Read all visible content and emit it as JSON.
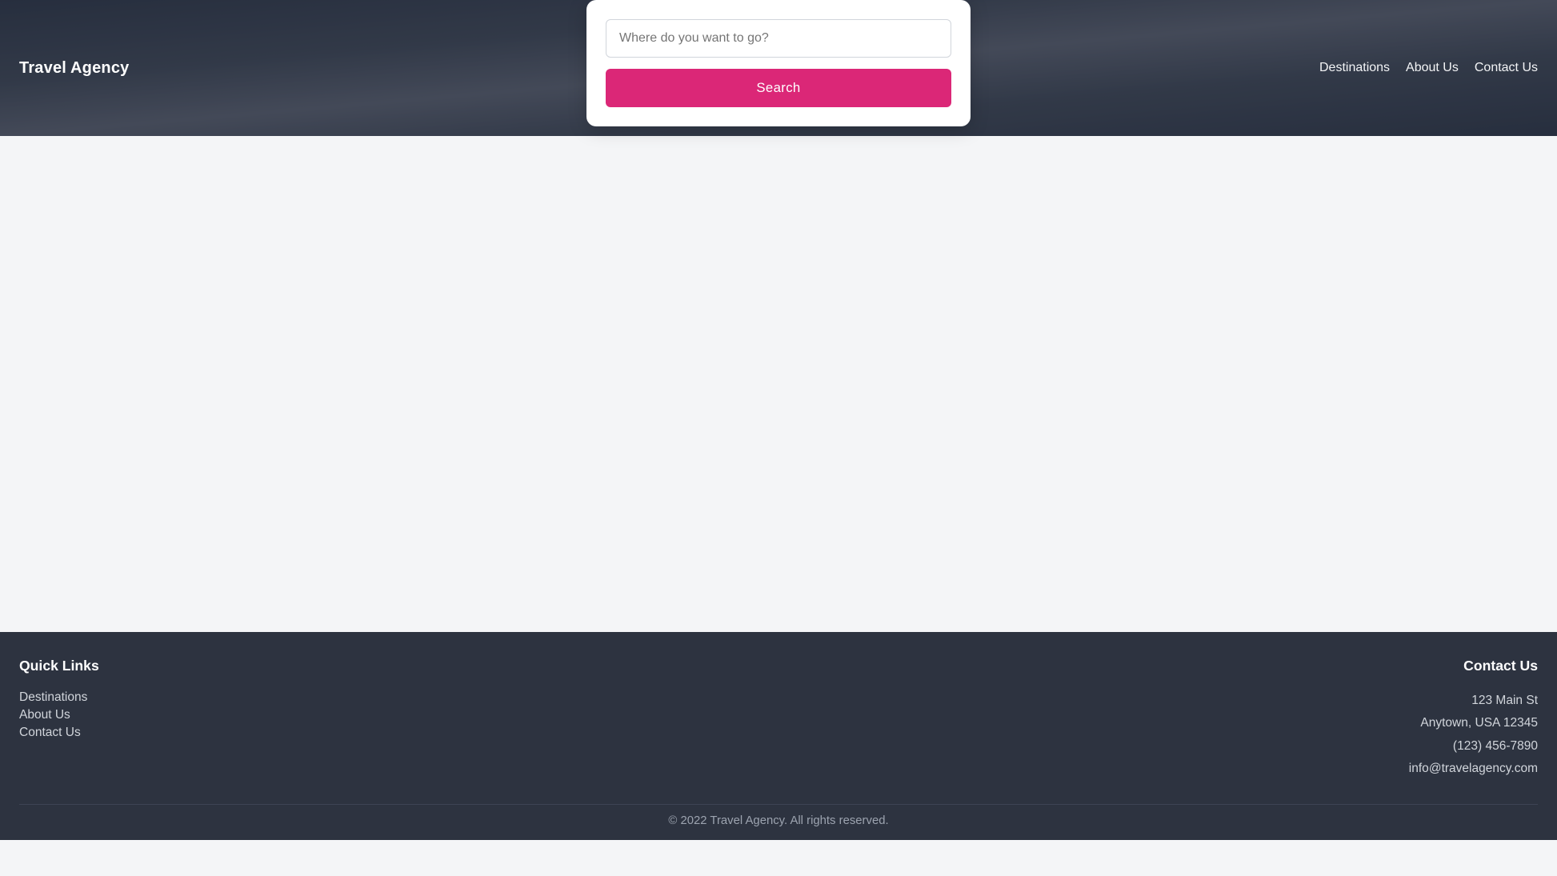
{
  "brand": "Travel Agency",
  "nav": {
    "items": [
      {
        "label": "Destinations",
        "href": "#"
      },
      {
        "label": "About Us",
        "href": "#"
      },
      {
        "label": "Contact Us",
        "href": "#"
      }
    ]
  },
  "search": {
    "placeholder": "Where do you want to go?",
    "button_label": "Search"
  },
  "footer": {
    "quick_links_heading": "Quick Links",
    "quick_links": [
      {
        "label": "Destinations",
        "href": "#"
      },
      {
        "label": "About Us",
        "href": "#"
      },
      {
        "label": "Contact Us",
        "href": "#"
      }
    ],
    "contact_heading": "Contact Us",
    "contact": {
      "address1": "123 Main St",
      "address2": "Anytown, USA 12345",
      "phone": "(123) 456-7890",
      "email": "info@travelagency.com"
    },
    "copyright": "© 2022 Travel Agency. All rights reserved."
  }
}
